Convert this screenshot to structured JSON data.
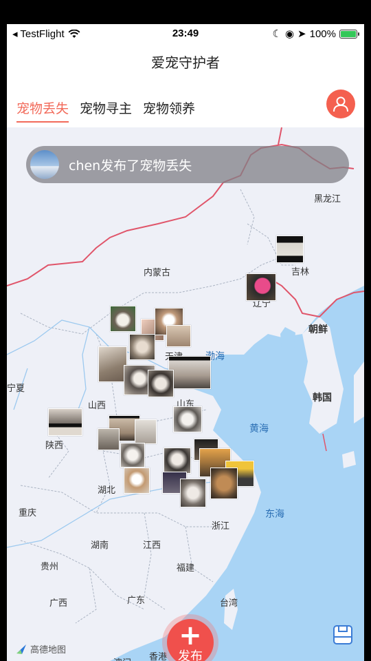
{
  "status_bar": {
    "back_app": "◂ TestFlight",
    "time": "23:49",
    "battery": "100%"
  },
  "header": {
    "title": "爱宠守护者",
    "tabs": [
      {
        "label": "宠物丢失",
        "active": true
      },
      {
        "label": "宠物寻主",
        "active": false
      },
      {
        "label": "宠物领养",
        "active": false
      }
    ],
    "profile_icon": "person-icon"
  },
  "banner": {
    "text": "chen发布了宠物丢失"
  },
  "map": {
    "labels": {
      "heilongjiang": "黑龙江",
      "jilin": "吉林",
      "liaoning": "辽宁",
      "neimenggu": "内蒙古",
      "chaoxian": "朝鲜",
      "hanguo": "韩国",
      "bohai": "渤海",
      "huanghai": "黄海",
      "donghai": "东海",
      "ningxia": "宁夏",
      "shanxi": "山西",
      "shaanxi": "陕西",
      "shandong": "山东",
      "hubei": "湖北",
      "chongqing": "重庆",
      "zhejiang": "浙江",
      "hunan": "湖南",
      "jiangxi": "江西",
      "guizhou": "贵州",
      "fujian": "福建",
      "guangxi": "广西",
      "guangdong": "广东",
      "taiwan": "台湾",
      "xianggang": "香港",
      "aomen": "澳门",
      "tianjin": "天津"
    },
    "attribution": "高德地图"
  },
  "fab": {
    "plus": "+",
    "label": "发布"
  },
  "colors": {
    "accent": "#f26a5a",
    "fab": "#f0504c",
    "sea": "#a9d4f5",
    "land": "#eef0f7",
    "border": "#e0556a"
  }
}
